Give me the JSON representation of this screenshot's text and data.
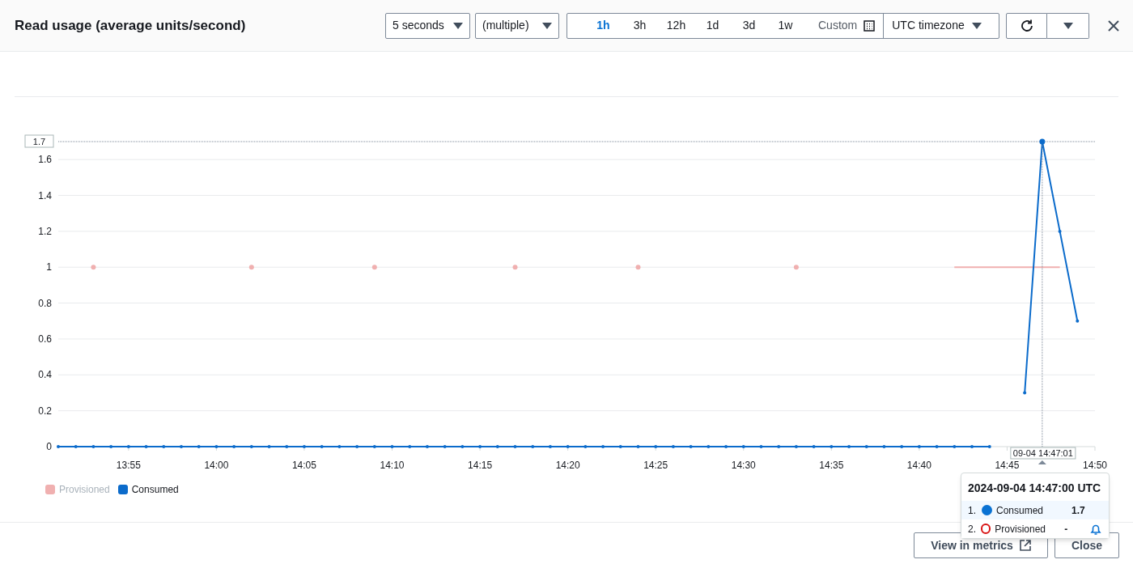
{
  "header": {
    "title": "Read usage (average units/second)",
    "period": "5 seconds",
    "statistic": "(multiple)",
    "ranges": [
      {
        "label": "1h",
        "selected": true
      },
      {
        "label": "3h",
        "selected": false
      },
      {
        "label": "12h",
        "selected": false
      },
      {
        "label": "1d",
        "selected": false
      },
      {
        "label": "3d",
        "selected": false
      },
      {
        "label": "1w",
        "selected": false
      }
    ],
    "custom": "Custom",
    "timezone": "UTC timezone"
  },
  "chart_data": {
    "type": "line",
    "grid": true,
    "ylim": [
      0,
      1.7
    ],
    "categories": [
      null,
      null,
      null,
      null,
      "13:55",
      null,
      null,
      null,
      null,
      "14:00",
      null,
      null,
      null,
      null,
      "14:05",
      null,
      null,
      null,
      null,
      "14:10",
      null,
      null,
      null,
      null,
      "14:15",
      null,
      null,
      null,
      null,
      "14:20",
      null,
      null,
      null,
      null,
      "14:25",
      null,
      null,
      null,
      null,
      "14:30",
      null,
      null,
      null,
      null,
      "14:35",
      null,
      null,
      null,
      null,
      "14:40",
      null,
      null,
      null,
      null,
      "14:45",
      null,
      null,
      null,
      null,
      "14:50"
    ],
    "yticks": [
      {
        "value": 0,
        "label": "0"
      },
      {
        "value": 0.2,
        "label": "0.2"
      },
      {
        "value": 0.4,
        "label": "0.4"
      },
      {
        "value": 0.6,
        "label": "0.6"
      },
      {
        "value": 0.8,
        "label": "0.8"
      },
      {
        "value": 1,
        "label": "1"
      },
      {
        "value": 1.2,
        "label": "1.2"
      },
      {
        "value": 1.4,
        "label": "1.4"
      },
      {
        "value": 1.6,
        "label": "1.6"
      }
    ],
    "series": [
      {
        "name": "Provisioned",
        "color": "#f0b0b0",
        "values": [
          null,
          null,
          1,
          null,
          null,
          null,
          null,
          null,
          null,
          null,
          null,
          1,
          null,
          null,
          null,
          null,
          null,
          null,
          1,
          null,
          null,
          null,
          null,
          null,
          null,
          null,
          1,
          null,
          null,
          null,
          null,
          null,
          null,
          1,
          null,
          null,
          null,
          null,
          null,
          null,
          null,
          null,
          1,
          null,
          null,
          null,
          null,
          null,
          null,
          null,
          null,
          1,
          1,
          1,
          1,
          1,
          1,
          1,
          null,
          null
        ]
      },
      {
        "name": "Consumed",
        "color": "#0b6bcb",
        "values": [
          0,
          0,
          0,
          0,
          0,
          0,
          0,
          0,
          0,
          0,
          0,
          0,
          0,
          0,
          0,
          0,
          0,
          0,
          0,
          0,
          0,
          0,
          0,
          0,
          0,
          0,
          0,
          0,
          0,
          0,
          0,
          0,
          0,
          0,
          0,
          0,
          0,
          0,
          0,
          0,
          0,
          0,
          0,
          0,
          0,
          0,
          0,
          0,
          0,
          0,
          0,
          0,
          0,
          0,
          null,
          0.3,
          1.7,
          1.2,
          0.7,
          null
        ]
      }
    ]
  },
  "hover": {
    "y_label": "1.7",
    "x_label": "09-04 14:47:01"
  },
  "legend": [
    {
      "dimmed": true
    },
    {
      "dimmed": false
    }
  ],
  "tooltip": {
    "title": "2024-09-04 14:47:00 UTC",
    "rows": [
      {
        "index": "1.",
        "name": "Consumed",
        "value": "1.7",
        "kind": "filled",
        "color": "#0972d3",
        "selected": true,
        "alarm_button": false
      },
      {
        "index": "2.",
        "name": "Provisioned",
        "value": "-",
        "kind": "ring",
        "color": "#d91515",
        "selected": false,
        "alarm_button": true
      }
    ]
  },
  "footer": {
    "buttons": [
      {
        "label": "View in metrics",
        "external": true
      },
      {
        "label": "Close",
        "external": false
      }
    ]
  }
}
